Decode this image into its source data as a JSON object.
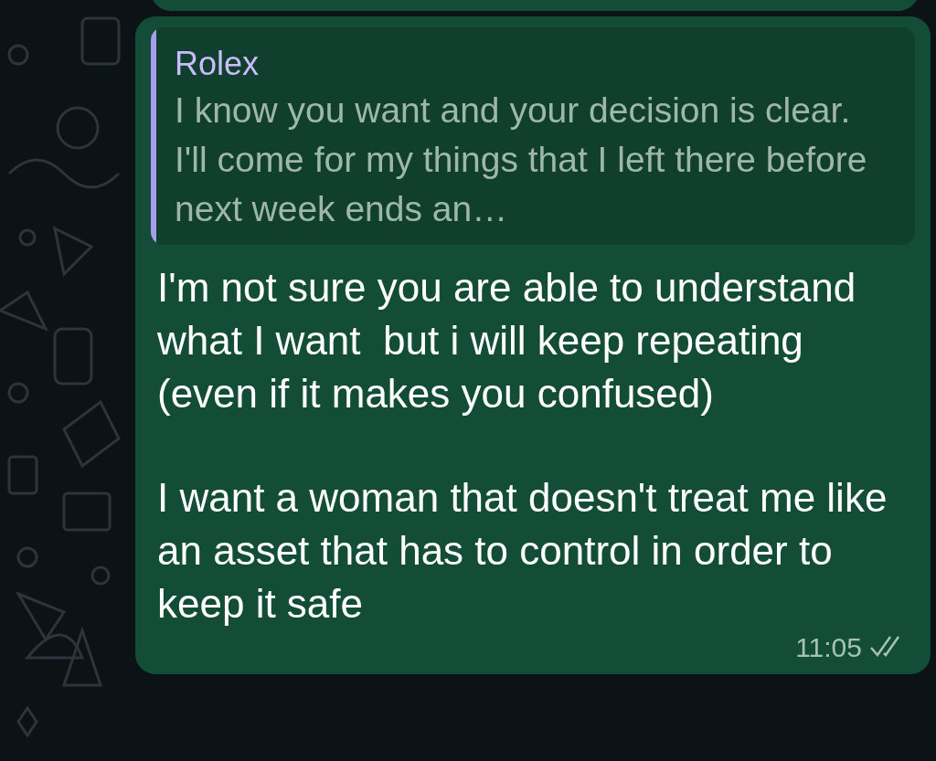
{
  "message": {
    "reply_to": {
      "sender": "Rolex",
      "text": "I know you want and your decision is clear. I'll come for my things that I left there before next week ends an…"
    },
    "paragraphs": [
      "I'm not sure you are able to understand what I want  but i will keep repeating (even if it makes you confused)",
      "I want a woman that doesn't treat me like an asset that has to control in order to keep it safe"
    ],
    "time": "11:05",
    "read": true
  }
}
